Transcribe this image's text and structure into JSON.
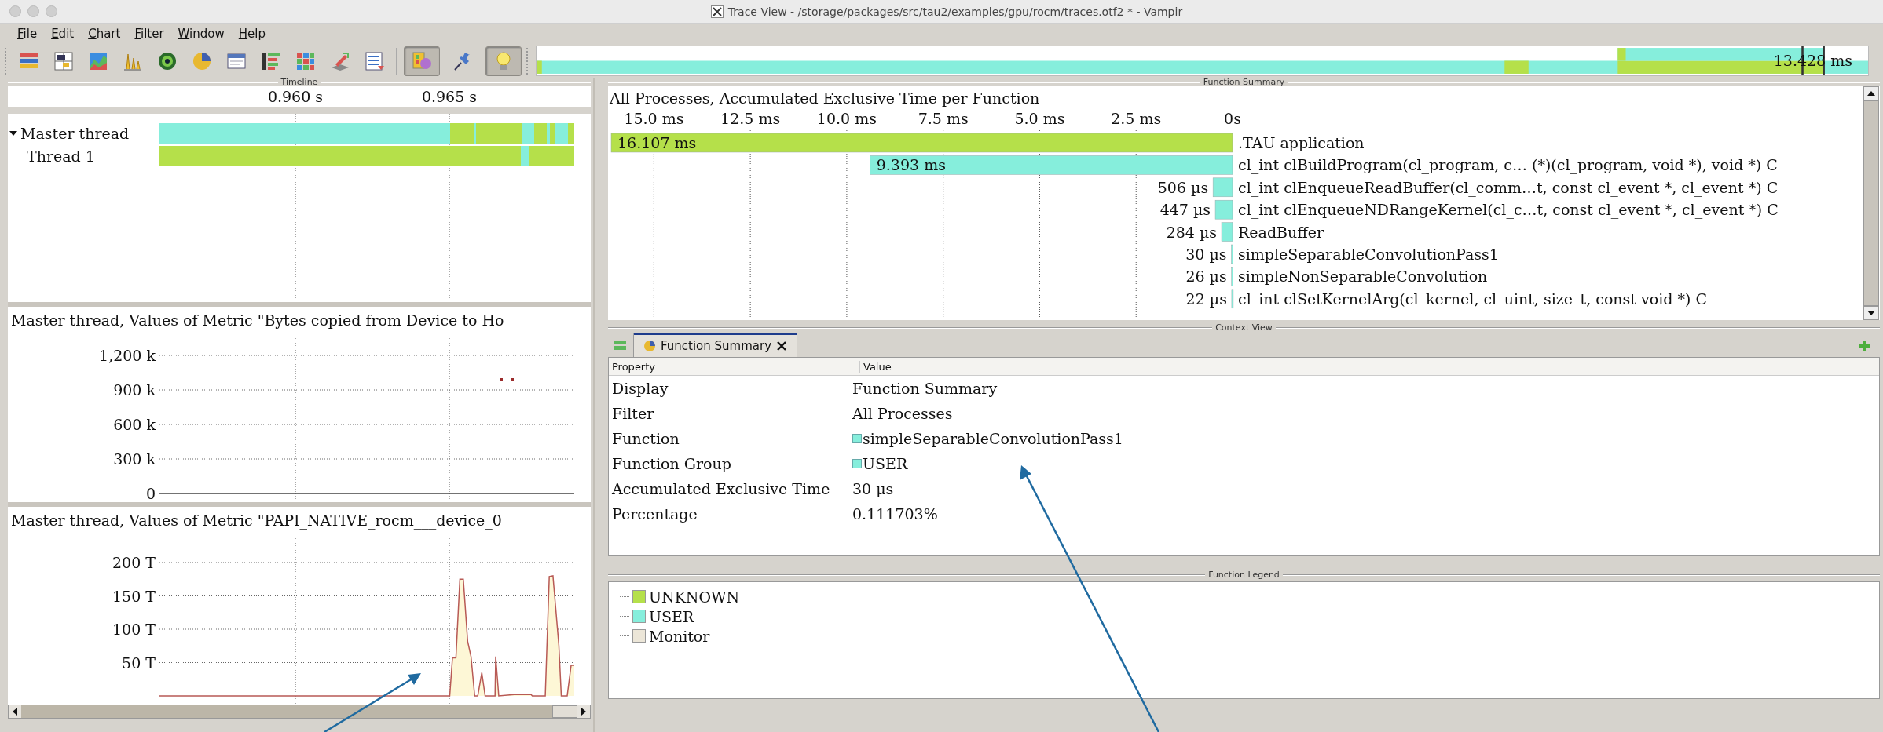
{
  "window": {
    "title": "Trace View - /storage/packages/src/tau2/examples/gpu/rocm/traces.otf2 * - Vampir"
  },
  "menu": [
    "File",
    "Edit",
    "Chart",
    "Filter",
    "Window",
    "Help"
  ],
  "toolbar": {
    "toggles": [
      {
        "selected": true
      },
      {
        "selected": false
      },
      {
        "selected": true
      }
    ]
  },
  "overview": {
    "reading": "13.428 ms"
  },
  "timeline": {
    "label": "Timeline",
    "ticks": [
      "0.960 s",
      "0.965 s"
    ],
    "threads": [
      {
        "name": "Master thread",
        "expanded": true,
        "children": [
          {
            "name": "Thread 1"
          }
        ]
      }
    ]
  },
  "metric_charts": [
    {
      "kind": "dots",
      "title": "Master thread, Values of Metric \"Bytes copied from Device to Ho",
      "axis_labels": [
        "1,200 k",
        "900 k",
        "600 k",
        "300 k",
        "0"
      ]
    },
    {
      "kind": "area",
      "title": "Master thread, Values of Metric \"PAPI_NATIVE_rocm___device_0",
      "axis_labels": [
        "200 T",
        "150 T",
        "100 T",
        "50 T"
      ]
    }
  ],
  "function_summary": {
    "label": "Function Summary",
    "chart_data": {
      "type": "bar",
      "orientation": "horizontal",
      "grid": true,
      "title": "All Processes, Accumulated Exclusive Time per Function",
      "categories": [
        ".TAU application",
        "cl_int clBuildProgram(cl_program, c… (*)(cl_program, void *), void *) C",
        "cl_int clEnqueueReadBuffer(cl_comm…t, const cl_event *, cl_event *) C",
        "cl_int clEnqueueNDRangeKernel(cl_c…t, const cl_event *, cl_event *) C",
        "ReadBuffer",
        "simpleSeparableConvolutionPass1",
        "simpleNonSeparableConvolution",
        "cl_int clSetKernelArg(cl_kernel, cl_uint, size_t, const void *) C"
      ],
      "series": [
        {
          "color": "#b5e04a",
          "values": [
            16.107,
            null,
            null,
            null,
            null,
            null,
            null,
            null
          ]
        },
        {
          "color": "#86eedc",
          "values": [
            null,
            9.393,
            0.506,
            0.447,
            0.284,
            0.03,
            0.026,
            0.022
          ]
        }
      ],
      "xlim": [
        16.107,
        0
      ],
      "xticks": [
        {
          "value": 15,
          "label": "15.0 ms"
        },
        {
          "value": 12.5,
          "label": "12.5 ms"
        },
        {
          "value": 10,
          "label": "10.0 ms"
        },
        {
          "value": 7.5,
          "label": "7.5 ms"
        },
        {
          "value": 5,
          "label": "5.0 ms"
        },
        {
          "value": 2.5,
          "label": "2.5 ms"
        },
        {
          "value": 0,
          "label": "0s"
        }
      ],
      "value_labels": [
        "16.107 ms",
        "9.393 ms",
        "506 µs",
        "447 µs",
        "284 µs",
        "30 µs",
        "26 µs",
        "22 µs"
      ]
    }
  },
  "context_view": {
    "label": "Context View",
    "tabs": [
      {
        "label": "Function Summary",
        "selected": true
      }
    ],
    "columns": [
      "Property",
      "Value"
    ],
    "rows": [
      {
        "property": "Display",
        "value": "Function Summary"
      },
      {
        "property": "Filter",
        "value": "All Processes"
      },
      {
        "property": "Function",
        "value": "simpleSeparableConvolutionPass1",
        "color": "#86eedc"
      },
      {
        "property": "Function Group",
        "value": "USER",
        "color": "#86eedc"
      },
      {
        "property": "Accumulated Exclusive Time",
        "value": "30 µs"
      },
      {
        "property": "Percentage",
        "value": "0.111703%"
      }
    ]
  },
  "function_legend": {
    "label": "Function Legend",
    "items": [
      {
        "name": "UNKNOWN",
        "color": "#b5e04a"
      },
      {
        "name": "USER",
        "color": "#86eedc"
      },
      {
        "name": "Monitor",
        "color": "#ece6d8"
      }
    ]
  }
}
